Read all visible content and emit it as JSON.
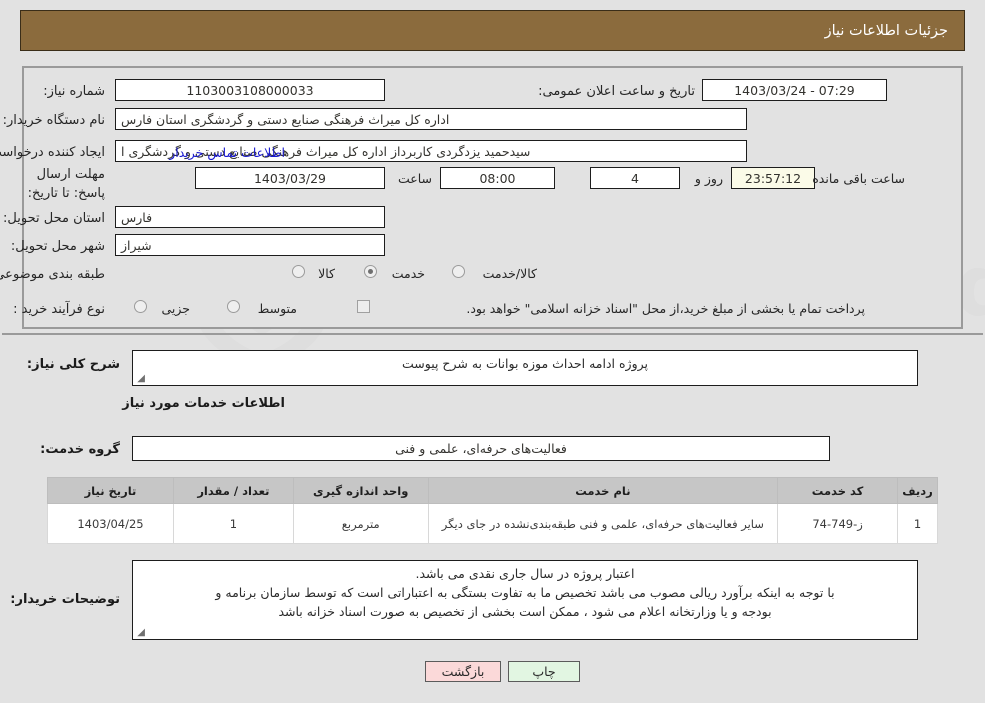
{
  "header": {
    "title": "جزئیات اطلاعات نیاز",
    "bg_color": "#8b6b3d"
  },
  "fields": {
    "need_number": {
      "label": "شماره نیاز:",
      "value": "1103003108000033"
    },
    "announce_date": {
      "label": "تاریخ و ساعت اعلان عمومی:",
      "value": "1403/03/24 - 07:29"
    },
    "buyer_org": {
      "label": "نام دستگاه خریدار:",
      "value": "اداره کل میراث فرهنگی  صنایع دستی و گردشگری استان فارس"
    },
    "request_creator": {
      "label": "ایجاد کننده درخواست:",
      "value": "سیدحمید یزدگردی کاربرداز اداره کل میراث فرهنگی  صنایع دستی و گردشگری ا"
    },
    "contact_link": "اطلاعات تماس خریدار",
    "deadline": {
      "label": "مهلت ارسال پاسخ: تا تاریخ:",
      "date": "1403/03/29",
      "hour_label": "ساعت",
      "hour": "08:00",
      "days": "4",
      "days_label": "روز و",
      "countdown": "23:57:12",
      "remaining_label": "ساعت باقی مانده"
    },
    "province": {
      "label": "استان محل تحویل:",
      "value": "فارس"
    },
    "city": {
      "label": "شهر محل تحویل:",
      "value": "شیراز"
    },
    "classification": {
      "label": "طبقه بندی موضوعی:",
      "options": [
        "کالا",
        "خدمت",
        "کالا/خدمت"
      ],
      "selected": "خدمت"
    },
    "process_type": {
      "label": "نوع فرآیند خرید :",
      "options": [
        "جزیی",
        "متوسط"
      ],
      "selected": "",
      "checkbox_label": "پرداخت تمام یا بخشی از مبلغ خرید،از محل \"اسناد خزانه اسلامی\" خواهد بود.",
      "checkbox_checked": false
    }
  },
  "summary": {
    "label": "شرح کلی نیاز:",
    "value": "پروژه ادامه احداث موزه بوانات به شرح پیوست"
  },
  "services_section": {
    "heading": "اطلاعات خدمات مورد نیاز",
    "group_label": "گروه خدمت:",
    "group_value": "فعالیت‌های حرفه‌ای، علمی و فنی"
  },
  "table": {
    "headers": [
      "ردیف",
      "کد خدمت",
      "نام خدمت",
      "واحد اندازه گیری",
      "تعداد / مقدار",
      "تاریخ نیاز"
    ],
    "rows": [
      {
        "row": "1",
        "code": "ز-749-74",
        "name": "سایر فعالیت‌های حرفه‌ای، علمی و فنی طبقه‌بندی‌نشده در جای دیگر",
        "unit": "مترمربع",
        "qty": "1",
        "date": "1403/04/25"
      }
    ]
  },
  "buyer_notes": {
    "label": "توضیحات خریدار:",
    "lines": [
      "اعتبار پروژه در سال جاری نقدی می باشد.",
      "با توجه به اینکه برآورد ریالی مصوب می باشد تخصیص ما به تفاوت بستگی به اعتباراتی است که توسط سازمان برنامه و",
      "بودجه و یا وزارتخانه اعلام می شود ، ممکن است بخشی از تخصیص به صورت اسناد خزانه باشد"
    ]
  },
  "buttons": {
    "print": "چاپ",
    "back": "بازگشت"
  },
  "watermark": {
    "text": "AriaTender.net"
  }
}
